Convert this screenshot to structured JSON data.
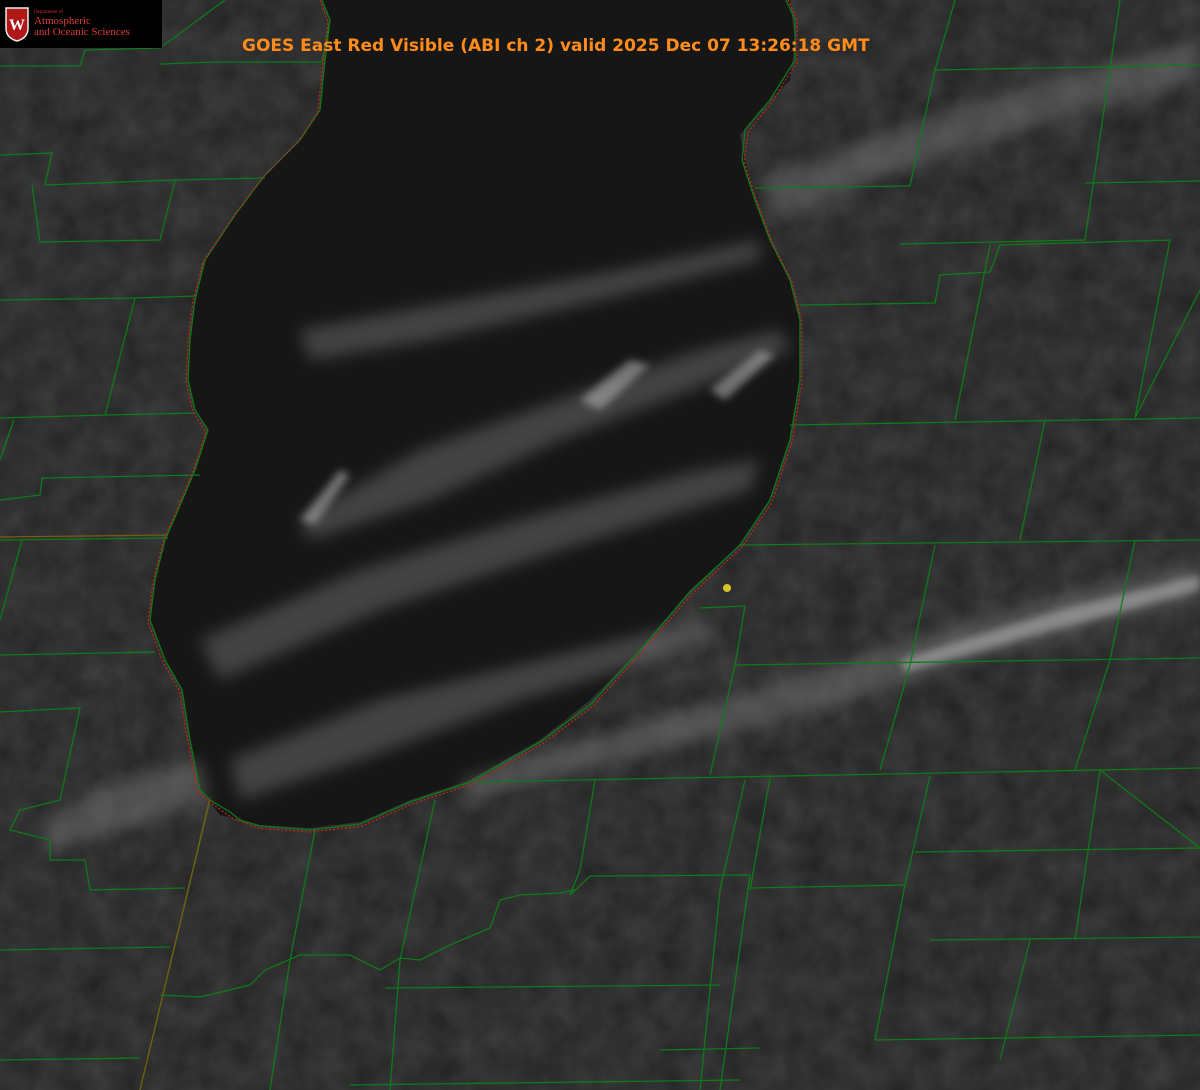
{
  "header": {
    "title": "GOES East Red Visible (ABI ch 2) valid 2025 Dec 07 13:26:18 GMT"
  },
  "logo": {
    "seal_letter": "W",
    "dept": "Department of",
    "line1": "Atmospheric",
    "line2": "and Oceanic Sciences"
  },
  "map": {
    "background": "#1e1e1e",
    "lake_color": "#151515",
    "boundary_color": "#0f7a1a",
    "shoreline_color": "#d02020",
    "station_color": "#d4c42a",
    "cloud_color": "#8a8a8a"
  },
  "icons": {
    "station": "station-dot",
    "seal": "university-seal"
  }
}
